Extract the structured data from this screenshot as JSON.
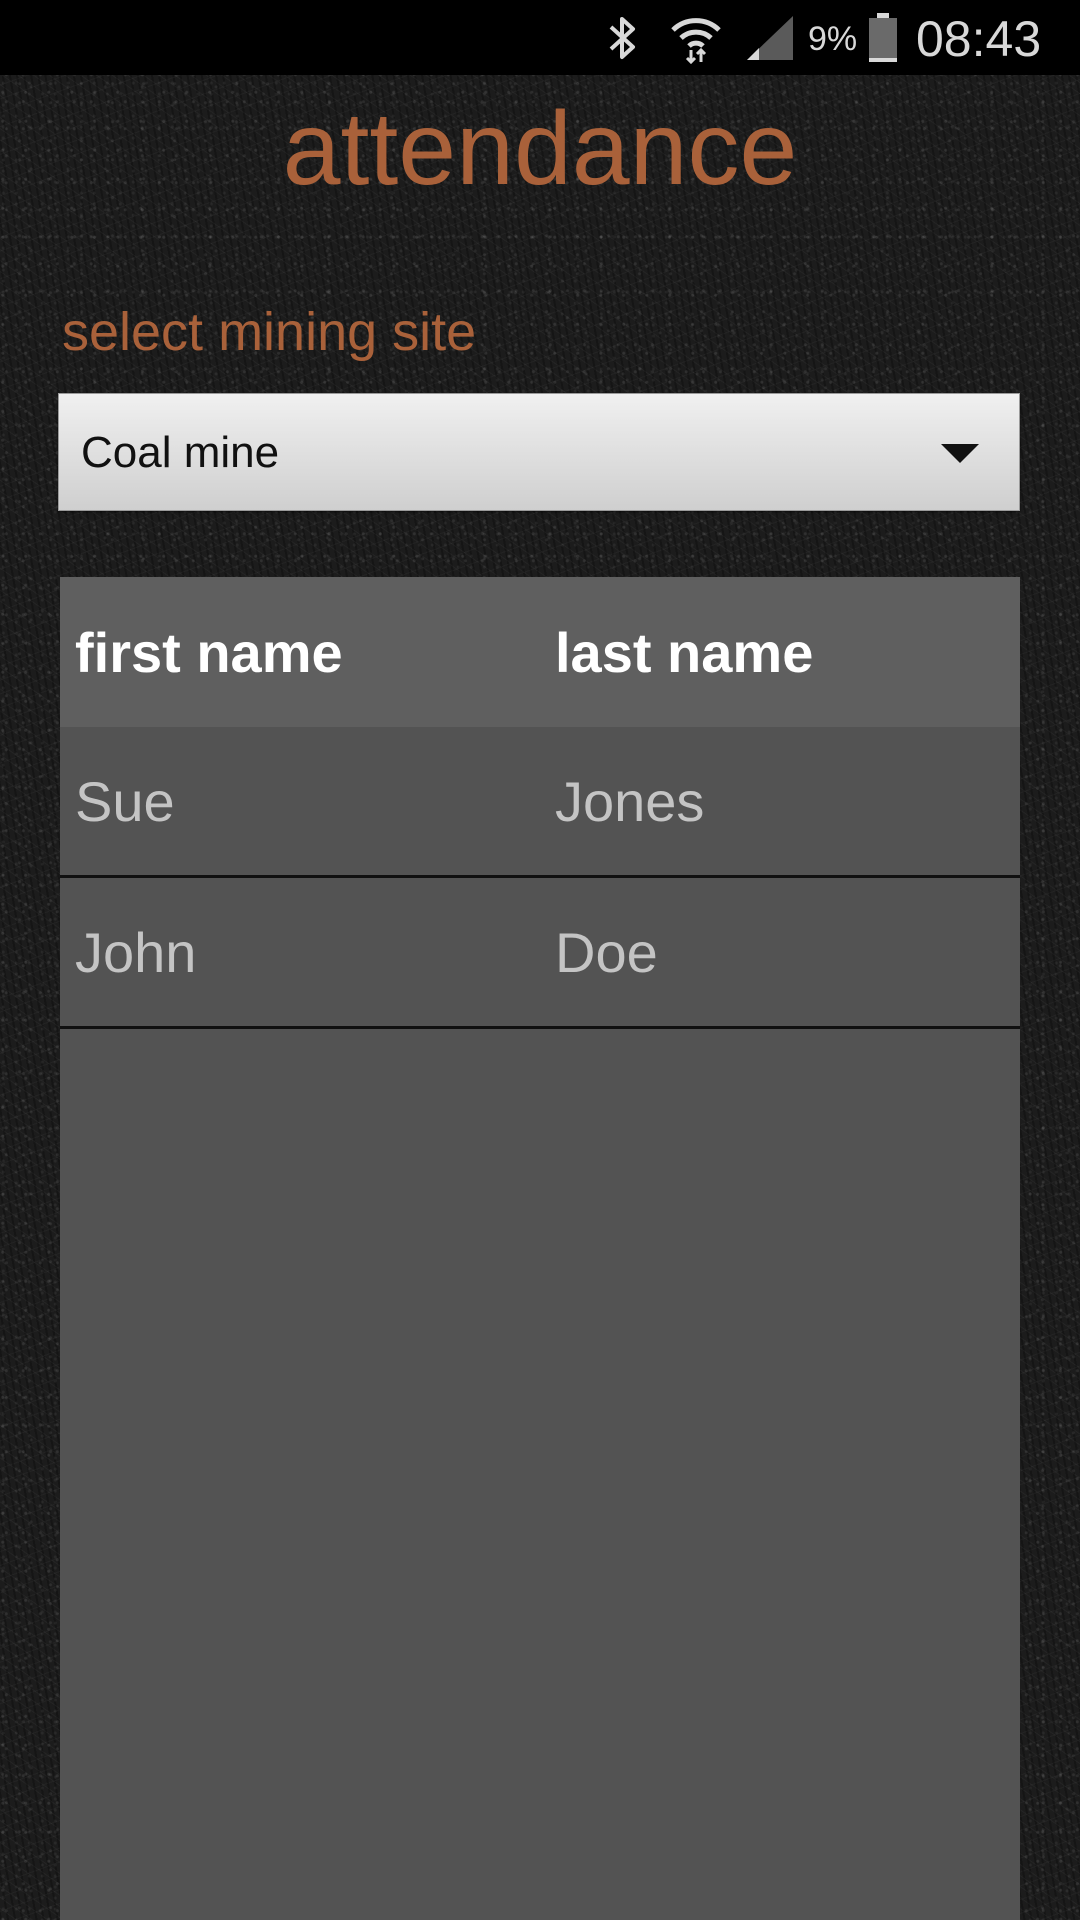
{
  "status_bar": {
    "battery_percent": "9%",
    "time": "08:43",
    "icons": [
      "bluetooth-icon",
      "wifi-icon",
      "signal-icon",
      "battery-icon"
    ]
  },
  "page": {
    "title": "attendance"
  },
  "site_select": {
    "label": "select mining site",
    "selected": "Coal mine"
  },
  "table": {
    "headers": {
      "first": "first name",
      "last": "last name"
    },
    "rows": [
      {
        "first": "Sue",
        "last": "Jones"
      },
      {
        "first": "John",
        "last": "Doe"
      }
    ]
  },
  "colors": {
    "accent": "#a9613a",
    "table_bg": "#535353",
    "header_bg": "#5f5f5f"
  }
}
